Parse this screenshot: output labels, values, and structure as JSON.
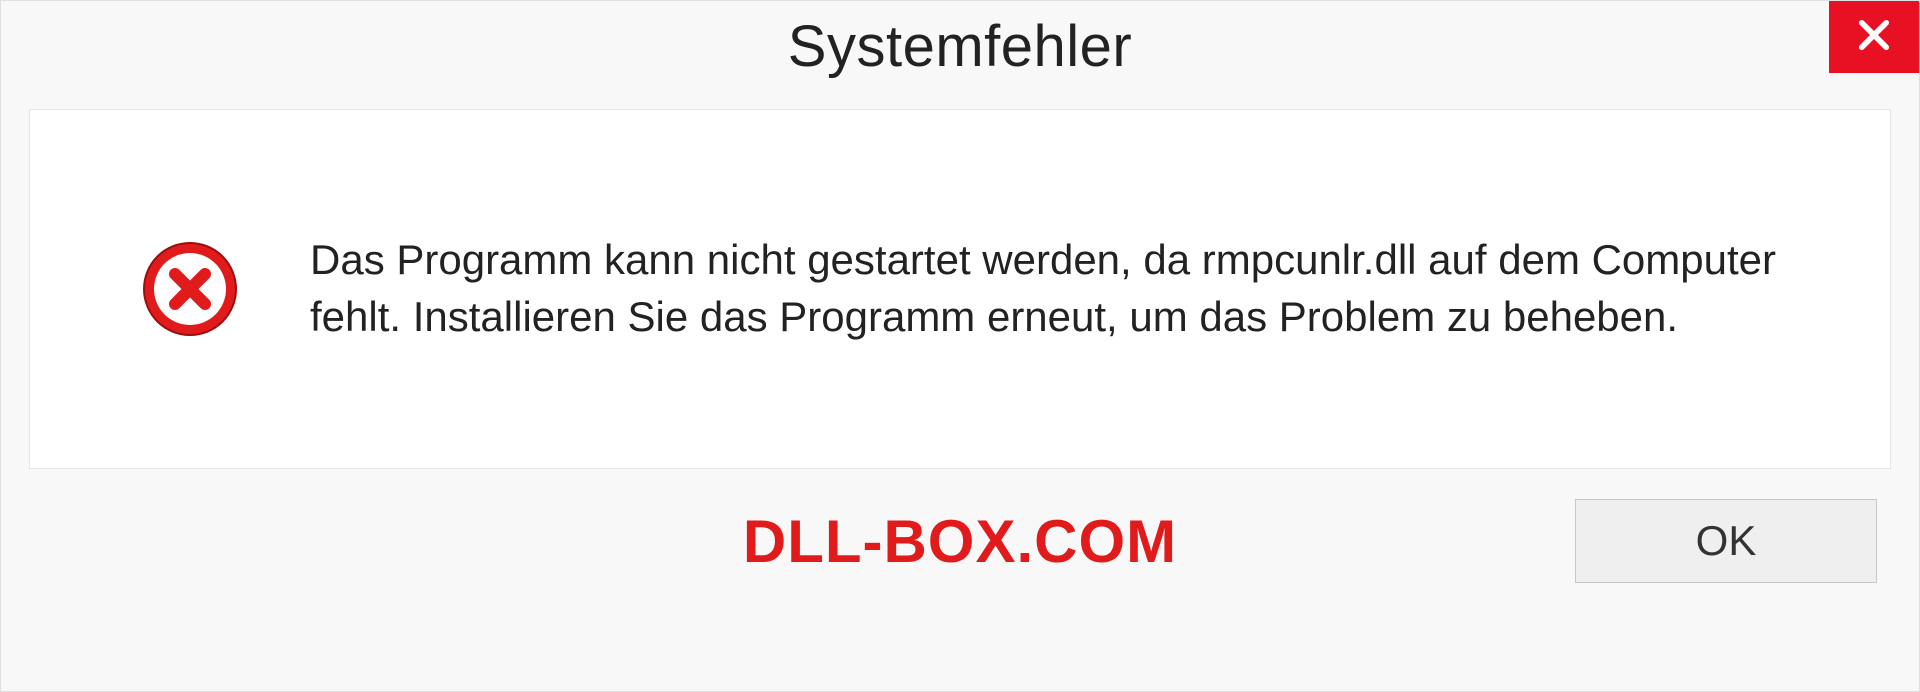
{
  "dialog": {
    "title": "Systemfehler",
    "message": "Das Programm kann nicht gestartet werden, da rmpcunlr.dll auf dem Computer fehlt. Installieren Sie das Programm erneut, um das Problem zu beheben.",
    "ok_label": "OK"
  },
  "watermark": "DLL-BOX.COM"
}
